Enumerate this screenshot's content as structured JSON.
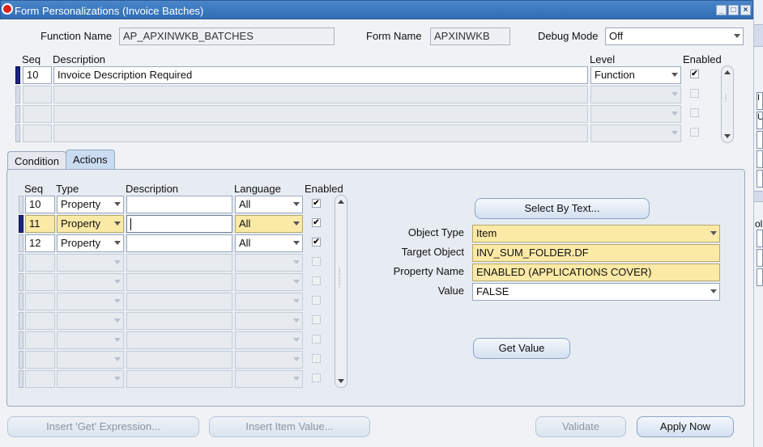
{
  "window": {
    "title": "Form Personalizations (Invoice Batches)"
  },
  "header": {
    "function_name_label": "Function Name",
    "function_name_value": "AP_APXINWKB_BATCHES",
    "form_name_label": "Form Name",
    "form_name_value": "APXINWKB",
    "debug_mode_label": "Debug Mode",
    "debug_mode_value": "Off"
  },
  "rules": {
    "columns": {
      "seq": "Seq",
      "description": "Description",
      "level": "Level",
      "enabled": "Enabled"
    },
    "rows": [
      {
        "seq": "10",
        "description": "Invoice Description Required",
        "level": "Function",
        "enabled": "✔"
      },
      {
        "seq": "",
        "description": "",
        "level": "",
        "enabled": ""
      },
      {
        "seq": "",
        "description": "",
        "level": "",
        "enabled": ""
      },
      {
        "seq": "",
        "description": "",
        "level": "",
        "enabled": ""
      }
    ]
  },
  "tabs": [
    {
      "label": "Condition"
    },
    {
      "label": "Actions"
    }
  ],
  "actions": {
    "columns": {
      "seq": "Seq",
      "type": "Type",
      "description": "Description",
      "language": "Language",
      "enabled": "Enabled"
    },
    "rows": [
      {
        "seq": "10",
        "type": "Property",
        "description": "",
        "language": "All",
        "enabled": "✔"
      },
      {
        "seq": "11",
        "type": "Property",
        "description": "",
        "language": "All",
        "enabled": "✔"
      },
      {
        "seq": "12",
        "type": "Property",
        "description": "",
        "language": "All",
        "enabled": "✔"
      },
      {
        "seq": "",
        "type": "",
        "description": "",
        "language": "",
        "enabled": ""
      },
      {
        "seq": "",
        "type": "",
        "description": "",
        "language": "",
        "enabled": ""
      },
      {
        "seq": "",
        "type": "",
        "description": "",
        "language": "",
        "enabled": ""
      },
      {
        "seq": "",
        "type": "",
        "description": "",
        "language": "",
        "enabled": ""
      },
      {
        "seq": "",
        "type": "",
        "description": "",
        "language": "",
        "enabled": ""
      },
      {
        "seq": "",
        "type": "",
        "description": "",
        "language": "",
        "enabled": ""
      },
      {
        "seq": "",
        "type": "",
        "description": "",
        "language": "",
        "enabled": ""
      }
    ]
  },
  "detail": {
    "select_by_text_label": "Select By Text...",
    "object_type_label": "Object Type",
    "object_type_value": "Item",
    "target_object_label": "Target Object",
    "target_object_value": "INV_SUM_FOLDER.DF",
    "property_name_label": "Property Name",
    "property_name_value": "ENABLED (APPLICATIONS COVER)",
    "value_label": "Value",
    "value_value": "FALSE",
    "get_value_label": "Get Value"
  },
  "footer": {
    "insert_get_expression_label": "Insert 'Get' Expression...",
    "insert_item_value_label": "Insert Item Value...",
    "validate_label": "Validate",
    "apply_now_label": "Apply Now"
  },
  "edge_fragments": {
    "top": "I",
    "mid": "U",
    "lower": "oli"
  },
  "colors": {
    "title_bar": "#2f6db5",
    "required_field": "#fbe9a6",
    "current_record": "#1a237e"
  }
}
